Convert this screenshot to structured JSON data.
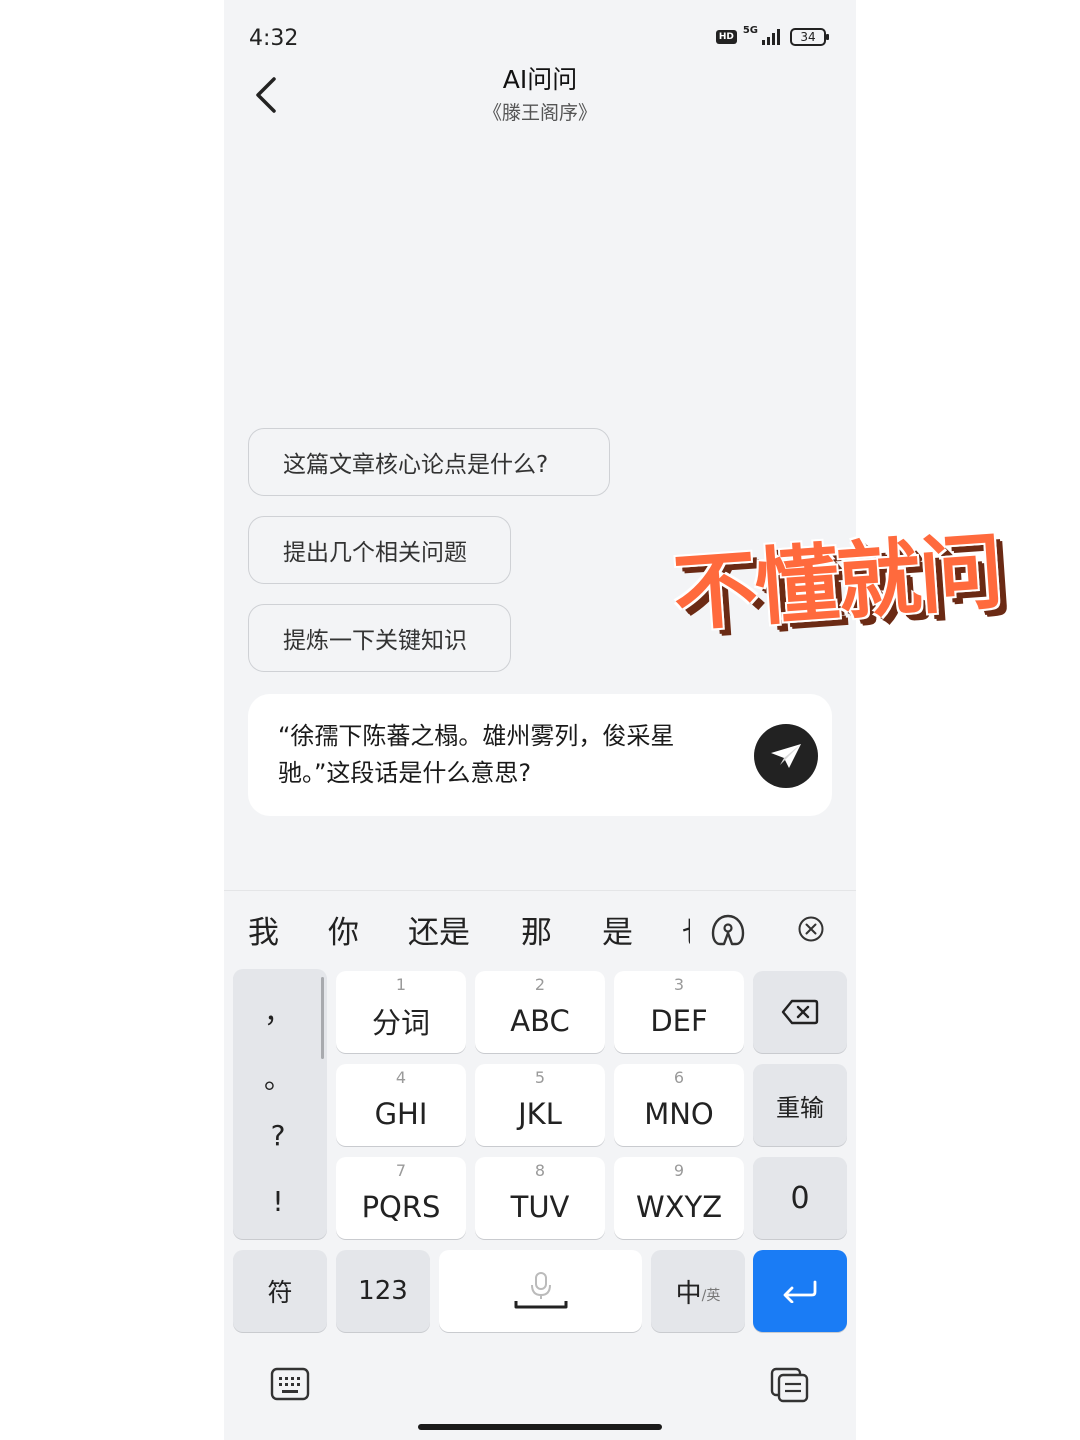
{
  "status_bar": {
    "time": "4:32",
    "hd": "HD",
    "network": "5G",
    "battery": "34"
  },
  "header": {
    "title": "AI问问",
    "subtitle": "《滕王阁序》"
  },
  "suggestions": [
    {
      "label": "这篇文章核心论点是什么?"
    },
    {
      "label": "提出几个相关问题"
    },
    {
      "label": "提炼一下关键知识"
    }
  ],
  "composer": {
    "text": "“徐孺下陈蕃之榻。雄州雾列，俊采星驰。”这段话是什么意思?"
  },
  "overlay_caption": "不懂就问",
  "keyboard": {
    "candidates": [
      "我",
      "你",
      "还是",
      "那",
      "是"
    ],
    "candidate_partial": "也",
    "punctuation": [
      "，",
      "。",
      "?",
      "!"
    ],
    "keys": [
      {
        "num": "1",
        "label": "分词"
      },
      {
        "num": "2",
        "label": "ABC"
      },
      {
        "num": "3",
        "label": "DEF"
      },
      {
        "num": "4",
        "label": "GHI"
      },
      {
        "num": "5",
        "label": "JKL"
      },
      {
        "num": "6",
        "label": "MNO"
      },
      {
        "num": "7",
        "label": "PQRS"
      },
      {
        "num": "8",
        "label": "TUV"
      },
      {
        "num": "9",
        "label": "WXYZ"
      }
    ],
    "reinput": "重输",
    "zero": "0",
    "symbols": "符",
    "numbers": "123",
    "lang_main": "中",
    "lang_alt": "/英"
  },
  "colors": {
    "enter": "#1a7cf5",
    "overlay": "#ff6a3d",
    "background": "#f3f4f6"
  }
}
